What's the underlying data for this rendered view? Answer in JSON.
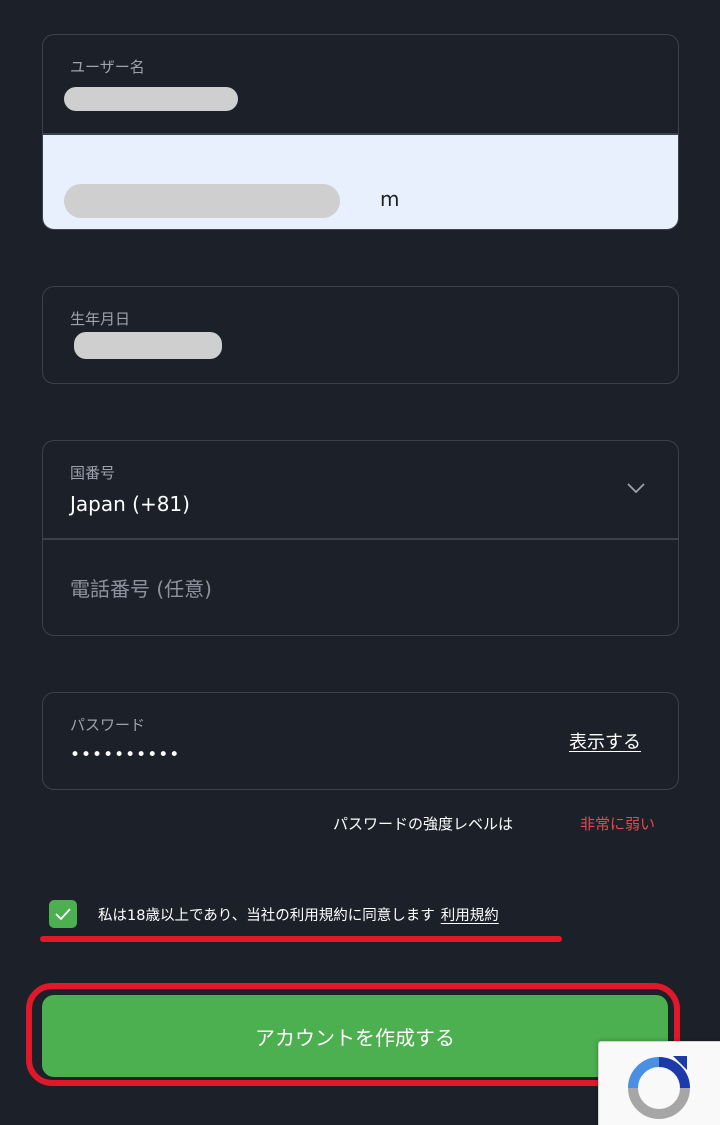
{
  "account": {
    "username_label": "ユーザー名",
    "email_visible_suffix": "m"
  },
  "birth": {
    "label": "生年月日"
  },
  "phone": {
    "country_label": "国番号",
    "country_value": "Japan (+81)",
    "phone_placeholder": "電話番号 (任意)"
  },
  "password": {
    "label": "パスワード",
    "value_mask": "••••••••••",
    "show_label": "表示する",
    "strength_label": "パスワードの強度レベルは",
    "strength_value": "非常に弱い"
  },
  "terms": {
    "text": "私は18歳以上であり、当社の利用規約に同意します",
    "link": "利用規約",
    "checked": true
  },
  "submit": {
    "label": "アカウントを作成する"
  },
  "colors": {
    "background": "#1c2029",
    "border": "#3b414d",
    "accent_green": "#4caf50",
    "strength_red": "#e5484d",
    "annotation_red": "#e0182b",
    "autofill_blue": "#e8f0fe"
  }
}
